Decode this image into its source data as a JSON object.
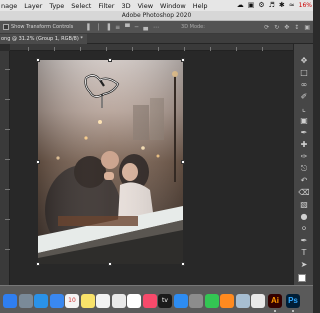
{
  "menubar": {
    "items": [
      "nage",
      "Layer",
      "Type",
      "Select",
      "Filter",
      "3D",
      "View",
      "Window",
      "Help"
    ],
    "tray": {
      "status_icons": [
        "adobe-cloud-icon",
        "screen-icon",
        "gear-icon",
        "audio-icon",
        "bluetooth-icon",
        "wifi-icon"
      ],
      "battery": "16%"
    }
  },
  "app": {
    "title": "Adobe Photoshop 2020"
  },
  "options_bar": {
    "show_transform_controls": "Show Transform Controls",
    "mode_3d": "3D Mode:",
    "align_icons": [
      "align-left-icon",
      "align-center-icon",
      "align-right-icon",
      "distribute-icon",
      "align-top-icon",
      "align-middle-icon",
      "align-bottom-icon",
      "more-icon"
    ]
  },
  "document": {
    "tab_label": "ong @ 31.2% (Group 1, RGB/8) *"
  },
  "tools": [
    "move-icon",
    "marquee-icon",
    "lasso-icon",
    "quick-select-icon",
    "crop-icon",
    "frame-icon",
    "eyedropper-icon",
    "healing-icon",
    "brush-icon",
    "stamp-icon",
    "history-brush-icon",
    "eraser-icon",
    "gradient-icon",
    "blur-icon",
    "dodge-icon",
    "pen-icon",
    "type-icon",
    "path-select-icon"
  ],
  "dock": {
    "apps": [
      {
        "name": "finder",
        "color": "#2f7ef0"
      },
      {
        "name": "launchpad",
        "color": "#7a8a98"
      },
      {
        "name": "safari",
        "color": "#2a92e8"
      },
      {
        "name": "mail",
        "color": "#3a88f0"
      },
      {
        "name": "calendar",
        "color": "#f4f4f4",
        "label": "10"
      },
      {
        "name": "notes",
        "color": "#f9e26a"
      },
      {
        "name": "reminders",
        "color": "#f2f2f2"
      },
      {
        "name": "chrome",
        "color": "#e9e9e9"
      },
      {
        "name": "photos",
        "color": "#ffffff"
      },
      {
        "name": "music",
        "color": "#f74a6b"
      },
      {
        "name": "apple-tv",
        "color": "#1a1a1a",
        "label": "tv"
      },
      {
        "name": "app-store",
        "color": "#2d8cf2"
      },
      {
        "name": "system-preferences",
        "color": "#8c8c8c"
      },
      {
        "name": "whatsapp",
        "color": "#33c653"
      },
      {
        "name": "firefox",
        "color": "#ff8a1f"
      },
      {
        "name": "preview",
        "color": "#a7bed2"
      },
      {
        "name": "chrome-alt",
        "color": "#e9e9e9"
      }
    ],
    "illustrator_label": "Ai",
    "photoshop_label": "Ps"
  }
}
